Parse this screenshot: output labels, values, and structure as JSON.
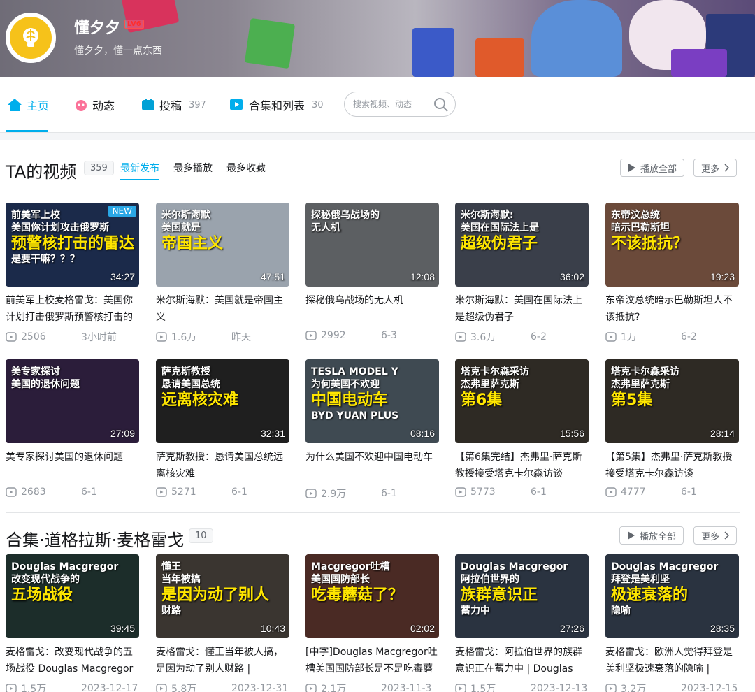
{
  "profile": {
    "name": "懂夕夕",
    "level": "LV6",
    "signature": "懂夕夕，懂一点东西"
  },
  "nav": {
    "items": [
      {
        "label": "主页",
        "count": "",
        "icon": "home-icon"
      },
      {
        "label": "动态",
        "count": "",
        "icon": "dynamic-icon"
      },
      {
        "label": "投稿",
        "count": "397",
        "icon": "upload-icon"
      },
      {
        "label": "合集和列表",
        "count": "30",
        "icon": "collection-icon"
      }
    ],
    "search_placeholder": "搜索视频、动态"
  },
  "videos_section": {
    "title": "TA的视频",
    "count": "359",
    "tabs": [
      "最新发布",
      "最多播放",
      "最多收藏"
    ],
    "play_all": "播放全部",
    "more": "更多",
    "videos": [
      {
        "cap1": "前美军上校",
        "cap2": "美国你计划攻击俄罗斯",
        "cap3": "预警核打击的雷达",
        "cap4": "是要干嘛？？？",
        "badge": "NEW",
        "duration": "34:27",
        "title": "前美军上校麦格雷戈：美国你计划打击俄罗斯预警核打击的",
        "views": "2506",
        "date": "3小时前",
        "bg": "#1b2a4a"
      },
      {
        "cap1": "米尔斯海默",
        "cap2": "美国就是",
        "cap3": "帝国主义",
        "cap4": "",
        "badge": "",
        "duration": "47:51",
        "title": "米尔斯海默：美国就是帝国主义",
        "views": "1.6万",
        "date": "昨天",
        "bg": "#9aa3ad"
      },
      {
        "cap1": "探秘俄乌战场的",
        "cap2": "无人机",
        "cap3": "",
        "cap4": "",
        "badge": "",
        "duration": "12:08",
        "title": "探秘俄乌战场的无人机",
        "views": "2992",
        "date": "6-3",
        "bg": "#5c5f62"
      },
      {
        "cap1": "米尔斯海默:",
        "cap2": "美国在国际法上是",
        "cap3": "超级伪君子",
        "cap4": "",
        "badge": "",
        "duration": "36:02",
        "title": "米尔斯海默：美国在国际法上是超级伪君子",
        "views": "3.6万",
        "date": "6-2",
        "bg": "#3a3f4a"
      },
      {
        "cap1": "东帝汶总统",
        "cap2": "暗示巴勒斯坦",
        "cap3": "不该抵抗？",
        "cap4": "",
        "badge": "",
        "duration": "19:23",
        "title": "东帝汶总统暗示巴勒斯坦人不该抵抗?",
        "views": "1万",
        "date": "6-2",
        "bg": "#6b4a3a"
      },
      {
        "cap1": "美专家探讨",
        "cap2": "美国的退休问题",
        "cap3": "",
        "cap4": "",
        "badge": "",
        "duration": "27:09",
        "title": "美专家探讨美国的退休问题",
        "views": "2683",
        "date": "6-1",
        "bg": "#2b1d3a"
      },
      {
        "cap1": "萨克斯教授",
        "cap2": "恳请美国总统",
        "cap3": "远离核灾难",
        "cap4": "",
        "badge": "",
        "duration": "32:31",
        "title": "萨克斯教授：恳请美国总统远离核灾难",
        "views": "5271",
        "date": "6-1",
        "bg": "#1f1f1f"
      },
      {
        "cap1": "TESLA MODEL Y",
        "cap2": "为何美国不欢迎",
        "cap3": "中国电动车",
        "cap4": "BYD YUAN PLUS",
        "badge": "",
        "duration": "08:16",
        "title": "为什么美国不欢迎中国电动车",
        "views": "2.9万",
        "date": "6-1",
        "bg": "#3f4a52"
      },
      {
        "cap1": "塔克卡尔森采访",
        "cap2": "杰弗里萨克斯",
        "cap3": "第6集",
        "cap4": "",
        "badge": "",
        "duration": "15:56",
        "title": "【第6集完结】杰弗里·萨克斯教授接受塔克卡尔森访谈",
        "views": "5773",
        "date": "6-1",
        "bg": "#2e2a24"
      },
      {
        "cap1": "塔克卡尔森采访",
        "cap2": "杰弗里萨克斯",
        "cap3": "第5集",
        "cap4": "",
        "badge": "",
        "duration": "28:14",
        "title": "【第5集】杰弗里·萨克斯教授接受塔克卡尔森访谈",
        "views": "4777",
        "date": "6-1",
        "bg": "#2e2a24"
      }
    ]
  },
  "collection_section": {
    "title": "合集·道格拉斯·麦格雷戈",
    "count": "10",
    "play_all": "播放全部",
    "more": "更多",
    "videos": [
      {
        "cap1": "Douglas Macgregor",
        "cap2": "改变现代战争的",
        "cap3": "五场战役",
        "duration": "39:45",
        "title": "麦格雷戈：改变现代战争的五场战役 Douglas Macgregor",
        "views": "1.5万",
        "date": "2023-12-17",
        "bg": "#1c2d2a"
      },
      {
        "cap1": "懂王",
        "cap2": "当年被搞",
        "cap3": "是因为动了别人",
        "cap4": "财路",
        "duration": "10:43",
        "title": "麦格雷戈：懂王当年被人搞，是因为动了别人财路 |",
        "views": "5.8万",
        "date": "2023-12-31",
        "bg": "#3a3530"
      },
      {
        "cap1": "Macgregor吐槽",
        "cap2": "美国国防部长",
        "cap3": "吃毒蘑菇了？",
        "duration": "02:02",
        "title": "[中字]Douglas Macgregor吐槽美国国防部长是不是吃毒蘑",
        "views": "2.1万",
        "date": "2023-11-3",
        "bg": "#4a2a24"
      },
      {
        "cap1": "Douglas Macgregor",
        "cap2": "阿拉伯世界的",
        "cap3": "族群意识正",
        "cap4": "蓄力中",
        "duration": "27:26",
        "title": "麦格雷戈：阿拉伯世界的族群意识正在蓄力中 | Douglas",
        "views": "1.5万",
        "date": "2023-12-13",
        "bg": "#2a3340"
      },
      {
        "cap1": "Douglas Macgregor",
        "cap2": "拜登是美利坚",
        "cap3": "极速衰落的",
        "cap4": "隐喻",
        "duration": "28:35",
        "title": "麦格雷戈：欧洲人觉得拜登是美利坚极速衰落的隐喻 |",
        "views": "3.2万",
        "date": "2023-12-15",
        "bg": "#2a3340"
      }
    ]
  }
}
